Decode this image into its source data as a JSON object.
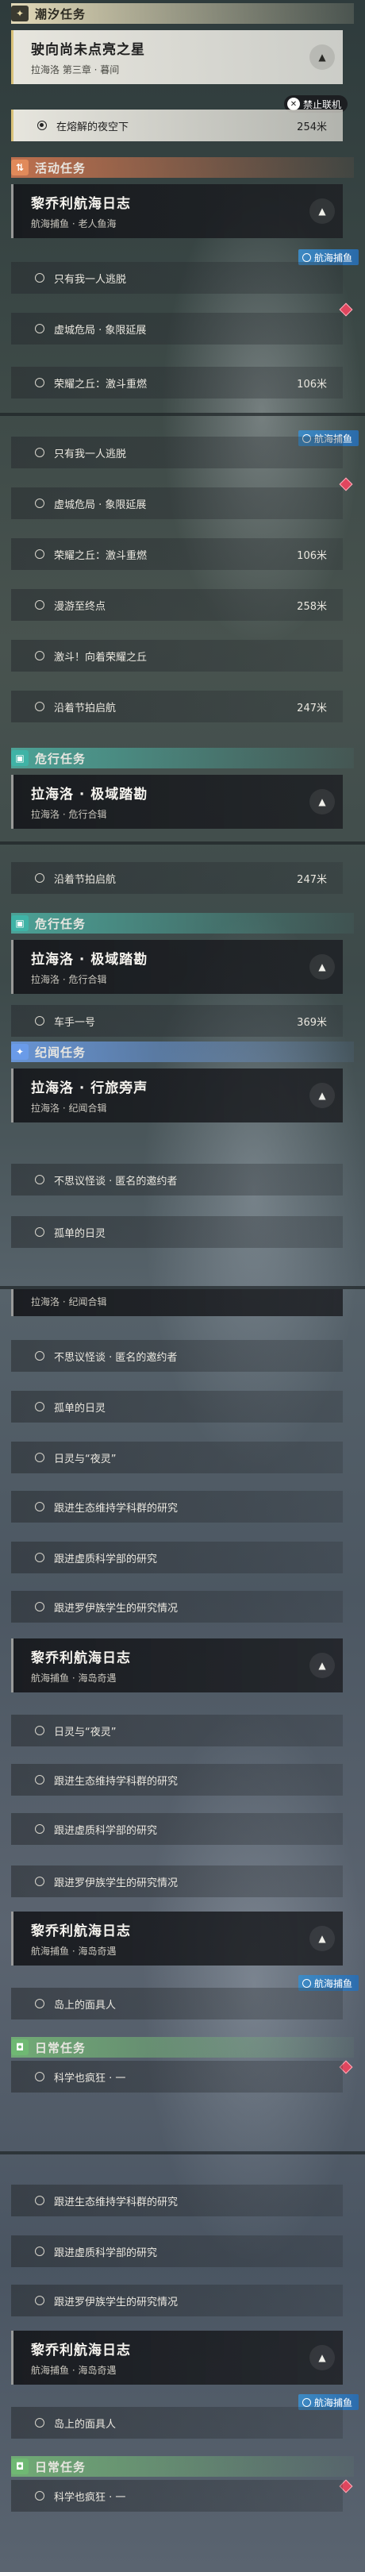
{
  "categories": {
    "tide": "潮汐任务",
    "activity": "活动任务",
    "danger": "危行任务",
    "record": "纪闻任务",
    "daily": "日常任务"
  },
  "icons": {
    "tide": "✦",
    "activity": "⇅",
    "danger": "▣",
    "record": "✦",
    "daily": "◘"
  },
  "quests": {
    "star": {
      "title": "驶向尚未点亮之星",
      "sub": "拉海洛 第三章 · 暮间"
    },
    "lichiao": {
      "title": "黎乔利航海日志",
      "sub": "航海捕鱼 · 老人鱼海"
    },
    "lichiao2": {
      "title": "黎乔利航海日志",
      "sub": "航海捕鱼 · 海岛奇遇"
    },
    "polar": {
      "title": "拉海洛 · 极域踏勘",
      "sub": "拉海洛 · 危行合辑"
    },
    "journey": {
      "title": "拉海洛 · 行旅旁声",
      "sub": "拉海洛 · 纪闻合辑"
    }
  },
  "objectives": {
    "night": "在熔解的夜空下",
    "alone": "只有我一人逃脱",
    "crisis": "虚城危局 · 象限延展",
    "glory": "荣耀之丘：激斗重燃",
    "drift": "漫游至终点",
    "gogo": "激斗！向着荣耀之丘",
    "shoot": "沿着节拍启航",
    "driver": "车手一号",
    "invite": "不思议怪谈 · 匿名的邀约者",
    "sun": "孤单的日灵",
    "night_sun": "日灵与“夜灵”",
    "eco": "跟进生态维持学科群的研究",
    "virtual": "跟进虚质科学部的研究",
    "lowe": "跟进罗伊族学生的研究情况",
    "island": "岛上的面具人",
    "crazy": "科学也疯狂 · 一"
  },
  "distances": {
    "night": "254米",
    "glory": "106米",
    "drift": "258米",
    "shoot": "247米",
    "driver": "369米"
  },
  "tags": {
    "fishing": "航海捕鱼",
    "coop": "禁止联机"
  },
  "colors": {
    "tide": "#ebe1be",
    "activity": "#d67850",
    "danger": "#50beaf",
    "record": "#6ea0eb",
    "daily": "#78be78",
    "marker": "#e0465e",
    "fishing_tag": "#3c8cc8"
  }
}
